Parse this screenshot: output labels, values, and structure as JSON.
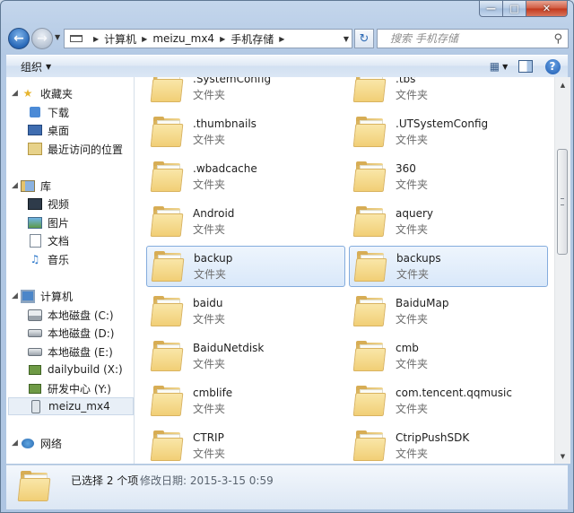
{
  "address": {
    "crumbs": [
      "计算机",
      "meizu_mx4",
      "手机存储"
    ]
  },
  "search": {
    "placeholder": "搜索 手机存储"
  },
  "toolbar": {
    "organize_label": "组织"
  },
  "nav": {
    "favorites": {
      "label": "收藏夹",
      "items": [
        "下载",
        "桌面",
        "最近访问的位置"
      ]
    },
    "libraries": {
      "label": "库",
      "items": [
        "视频",
        "图片",
        "文档",
        "音乐"
      ]
    },
    "computer": {
      "label": "计算机",
      "items": [
        "本地磁盘 (C:)",
        "本地磁盘 (D:)",
        "本地磁盘 (E:)",
        "dailybuild (X:)",
        "研发中心 (Y:)",
        "meizu_mx4"
      ]
    },
    "network": {
      "label": "网络"
    }
  },
  "files": [
    {
      "name": ".SystemConfig",
      "type": "文件夹"
    },
    {
      "name": ".tbs",
      "type": "文件夹"
    },
    {
      "name": ".thumbnails",
      "type": "文件夹"
    },
    {
      "name": ".UTSystemConfig",
      "type": "文件夹"
    },
    {
      "name": ".wbadcache",
      "type": "文件夹"
    },
    {
      "name": "360",
      "type": "文件夹"
    },
    {
      "name": "Android",
      "type": "文件夹"
    },
    {
      "name": "aquery",
      "type": "文件夹"
    },
    {
      "name": "backup",
      "type": "文件夹"
    },
    {
      "name": "backups",
      "type": "文件夹"
    },
    {
      "name": "baidu",
      "type": "文件夹"
    },
    {
      "name": "BaiduMap",
      "type": "文件夹"
    },
    {
      "name": "BaiduNetdisk",
      "type": "文件夹"
    },
    {
      "name": "cmb",
      "type": "文件夹"
    },
    {
      "name": "cmblife",
      "type": "文件夹"
    },
    {
      "name": "com.tencent.qqmusic",
      "type": "文件夹"
    },
    {
      "name": "CTRIP",
      "type": "文件夹"
    },
    {
      "name": "CtripPushSDK",
      "type": "文件夹"
    }
  ],
  "details": {
    "selection": "已选择 2 个项",
    "modified": "修改日期: 2015-3-15 0:59"
  }
}
